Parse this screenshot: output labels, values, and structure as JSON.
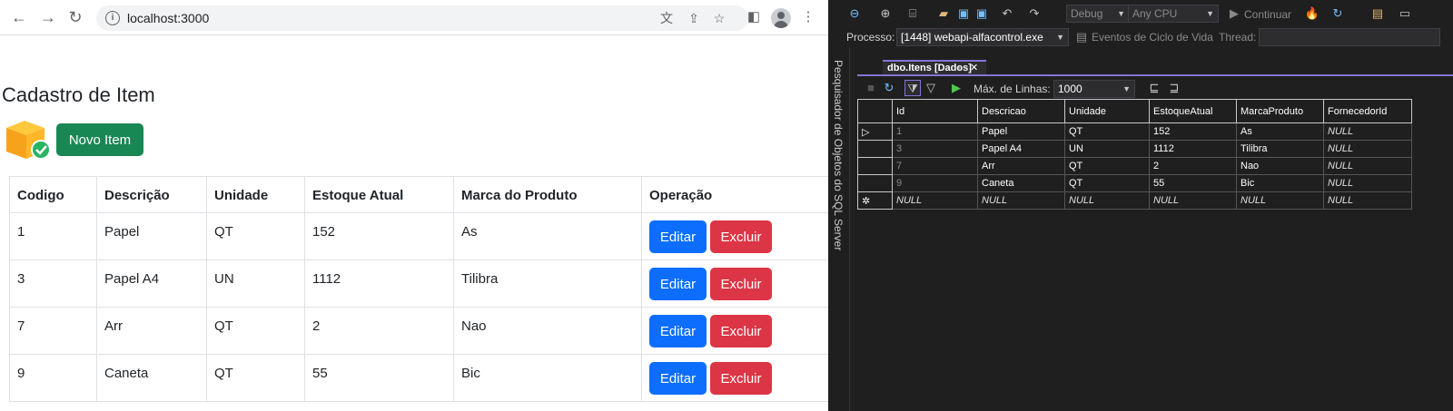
{
  "browser": {
    "url": "localhost:3000"
  },
  "page": {
    "title": "Cadastro de Item",
    "new_item_label": "Novo Item",
    "columns": [
      "Codigo",
      "Descrição",
      "Unidade",
      "Estoque Atual",
      "Marca do Produto",
      "Operação"
    ],
    "rows": [
      {
        "codigo": "1",
        "descricao": "Papel",
        "unidade": "QT",
        "estoque": "152",
        "marca": "As"
      },
      {
        "codigo": "3",
        "descricao": "Papel A4",
        "unidade": "UN",
        "estoque": "1112",
        "marca": "Tilibra"
      },
      {
        "codigo": "7",
        "descricao": "Arr",
        "unidade": "QT",
        "estoque": "2",
        "marca": "Nao"
      },
      {
        "codigo": "9",
        "descricao": "Caneta",
        "unidade": "QT",
        "estoque": "55",
        "marca": "Bic"
      }
    ],
    "edit_label": "Editar",
    "delete_label": "Excluir",
    "colors": {
      "new": "#198754",
      "edit": "#0d6efd",
      "delete": "#dc3545"
    }
  },
  "vs": {
    "config": "Debug",
    "platform": "Any CPU",
    "continue_label": "Continuar",
    "process_label": "Processo:",
    "process_value": "[1448] webapi-alfacontrol.exe",
    "lifecycle_label": "Eventos de Ciclo de Vida",
    "thread_label": "Thread:",
    "side_panel_label": "Pesquisador de Objetos do SQL Server",
    "doc_tab": "dbo.Itens [Dados]",
    "max_rows_label": "Máx. de Linhas:",
    "max_rows_value": "1000",
    "grid_columns": [
      "Id",
      "Descricao",
      "Unidade",
      "EstoqueAtual",
      "MarcaProduto",
      "FornecedorId"
    ],
    "grid_rows": [
      [
        "1",
        "Papel",
        "QT",
        "152",
        "As",
        "NULL"
      ],
      [
        "3",
        "Papel A4",
        "UN",
        "1112",
        "Tilibra",
        "NULL"
      ],
      [
        "7",
        "Arr",
        "QT",
        "2",
        "Nao",
        "NULL"
      ],
      [
        "9",
        "Caneta",
        "QT",
        "55",
        "Bic",
        "NULL"
      ],
      [
        "NULL",
        "NULL",
        "NULL",
        "NULL",
        "NULL",
        "NULL"
      ]
    ]
  }
}
